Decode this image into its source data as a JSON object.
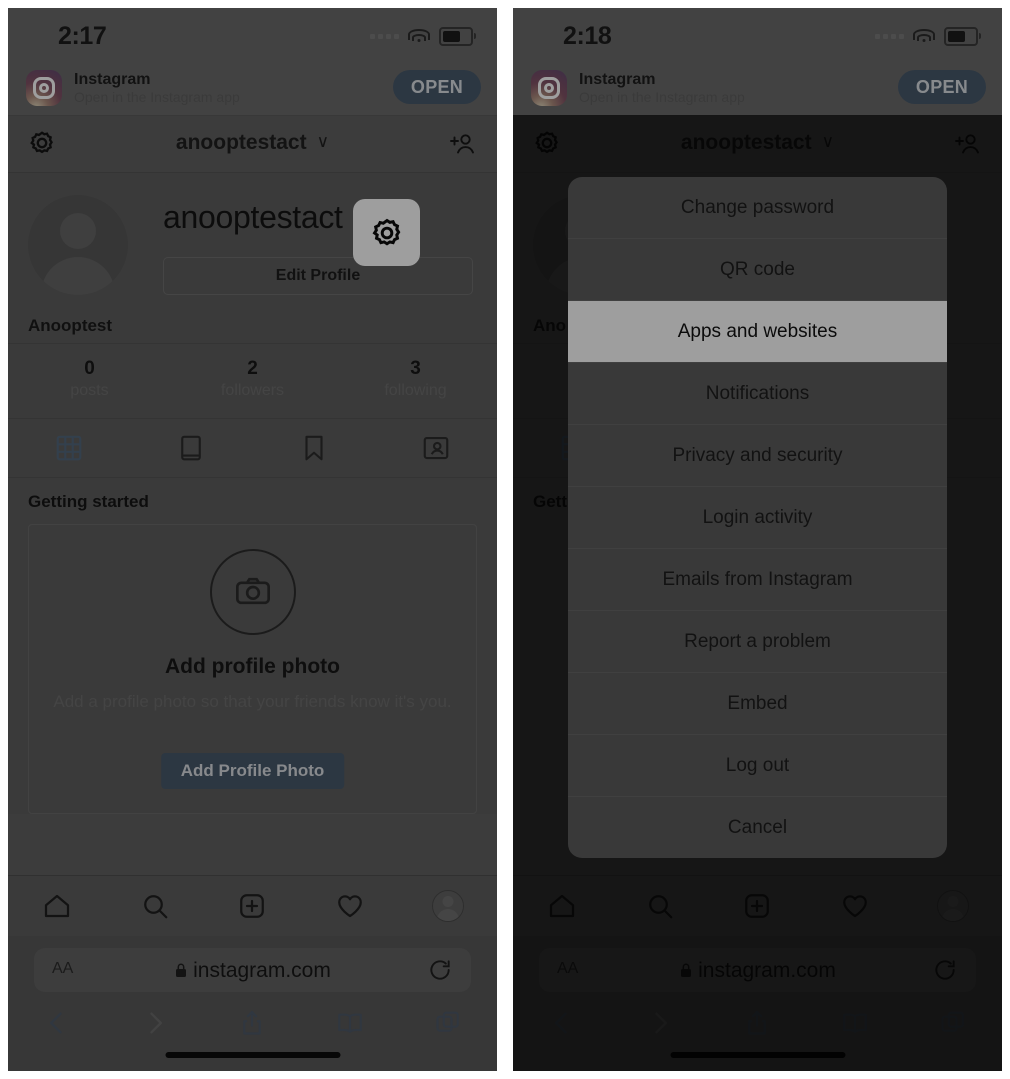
{
  "panels": {
    "left": {
      "status": {
        "time": "2:17"
      },
      "app_banner": {
        "app_name": "Instagram",
        "subtitle": "Open in the Instagram app",
        "open_label": "OPEN"
      },
      "nav": {
        "username": "anooptestact",
        "chevron": "∨"
      },
      "profile": {
        "username": "anooptestact",
        "edit_profile_label": "Edit Profile",
        "full_name": "Anooptest"
      },
      "stats": [
        {
          "value": "0",
          "label": "posts"
        },
        {
          "value": "2",
          "label": "followers"
        },
        {
          "value": "3",
          "label": "following"
        }
      ],
      "tabs": [
        {
          "name": "grid-tab",
          "active": true
        },
        {
          "name": "igtv-tab",
          "active": false
        },
        {
          "name": "saved-tab",
          "active": false
        },
        {
          "name": "tagged-tab",
          "active": false
        }
      ],
      "getting_started": {
        "section_title": "Getting started",
        "card_title": "Add profile photo",
        "card_text": "Add a profile photo so that your friends know it's you.",
        "button_label": "Add Profile Photo"
      },
      "browser": {
        "text_size_label": "AA",
        "url": "instagram.com"
      }
    },
    "right": {
      "status": {
        "time": "2:18"
      },
      "app_banner": {
        "app_name": "Instagram",
        "subtitle": "Open in the Instagram app",
        "open_label": "OPEN"
      },
      "nav": {
        "username": "anooptestact",
        "chevron": "∨"
      },
      "profile": {
        "full_name": "Ano"
      },
      "getting_started": {
        "section_title": "Gett"
      },
      "browser": {
        "text_size_label": "AA",
        "url": "instagram.com"
      },
      "action_sheet": {
        "items": [
          {
            "label": "Change password",
            "selected": false
          },
          {
            "label": "QR code",
            "selected": false
          },
          {
            "label": "Apps and websites",
            "selected": true
          },
          {
            "label": "Notifications",
            "selected": false
          },
          {
            "label": "Privacy and security",
            "selected": false
          },
          {
            "label": "Login activity",
            "selected": false
          },
          {
            "label": "Emails from Instagram",
            "selected": false
          },
          {
            "label": "Report a problem",
            "selected": false
          },
          {
            "label": "Embed",
            "selected": false
          },
          {
            "label": "Log out",
            "selected": false
          },
          {
            "label": "Cancel",
            "selected": false
          }
        ]
      }
    }
  },
  "colors": {
    "accent_blue": "#1a5fa8",
    "safari_blue": "#2f5d96",
    "highlight_white": "#ffffff",
    "grid_tab_active": "#1f6fc4"
  }
}
